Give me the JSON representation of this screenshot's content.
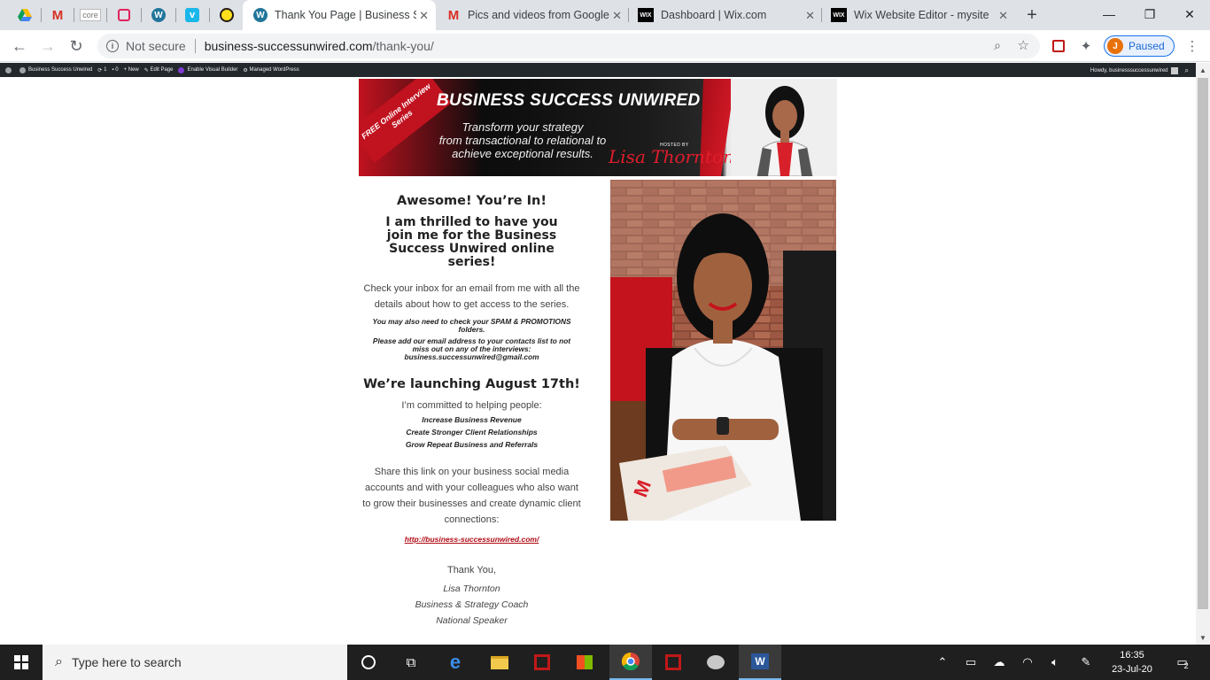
{
  "browser": {
    "tabs": [
      {
        "label": "core",
        "icon": "core-favicon"
      },
      {
        "label": "Thank You Page | Business Su",
        "icon": "wordpress-icon",
        "active": true
      },
      {
        "label": "Pics and videos from Google",
        "icon": "gmail-icon"
      },
      {
        "label": "Dashboard | Wix.com",
        "icon": "wix-icon"
      },
      {
        "label": "Wix Website Editor - mysite",
        "icon": "wix-icon"
      }
    ],
    "new_tab": "+",
    "address": {
      "security": "Not secure",
      "host": "business-successunwired.com",
      "path": "/thank-you/"
    },
    "profile": {
      "initial": "J",
      "status": "Paused"
    },
    "window_controls": {
      "minimize": "—",
      "restore": "❐",
      "close": "✕"
    }
  },
  "wp_admin_bar": {
    "site": "Business Success Unwired",
    "updates": "1",
    "comments": "0",
    "new": "New",
    "edit": "Edit Page",
    "builder": "Enable Visual Builder",
    "managed": "Managed WordPress",
    "howdy": "Howdy, businesssuccessunwired"
  },
  "banner": {
    "ribbon": "FREE Online Interview Series",
    "title": "BUSINESS SUCCESS UNWIRED",
    "subtitle_1": "Transform your strategy",
    "subtitle_2": "from transactional to relational to",
    "subtitle_3": "achieve exceptional results.",
    "hosted_by": "HOSTED BY",
    "signature": "Lisa Thornton"
  },
  "content": {
    "heading": "Awesome! You’re In!",
    "subheading": "I am thrilled to have you join me for the Business Success Unwired online series!",
    "inbox_text": "Check your inbox for an email from me with all the details about how to get access to the series.",
    "spam_note": "You may also need to check your SPAM & PROMOTIONS folders.",
    "contacts_note": "Please add our email address to your contacts list to not miss out on any of the interviews:",
    "email": "business.successunwired@gmail.com",
    "launch_heading": "We’re launching August 17th!",
    "committed": "I’m committed to helping people:",
    "bullets": [
      "Increase Business Revenue",
      "Create Stronger Client Relationships",
      "Grow Repeat Business and Referrals"
    ],
    "share_text": "Share this link on your business social media accounts and with your colleagues who also want to grow their businesses and create dynamic client connections:",
    "share_link": "http://business-successunwired.com/",
    "thanks": "Thank You,",
    "name": "Lisa Thornton",
    "role_1": "Business & Strategy Coach",
    "role_2": "National Speaker"
  },
  "taskbar": {
    "search_placeholder": "Type here to search",
    "time": "16:35",
    "date": "23-Jul-20",
    "notifications": "2"
  },
  "colors": {
    "brand_red": "#c1121f",
    "link_red": "#b00b14",
    "chrome_tabs": "#dee1e6",
    "wp_bar": "#23282d",
    "taskbar": "#1f1f1f"
  }
}
